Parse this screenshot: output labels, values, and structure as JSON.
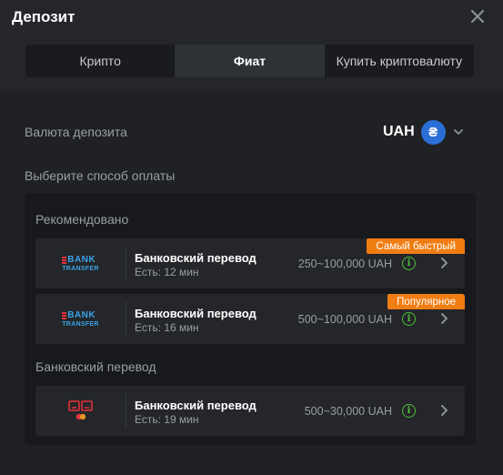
{
  "dialog": {
    "title": "Депозит",
    "close_icon": "close-icon"
  },
  "tabs": [
    {
      "label": "Крипто",
      "active": false
    },
    {
      "label": "Фиат",
      "active": true
    },
    {
      "label": "Купить криптовалюту",
      "active": false
    }
  ],
  "deposit_currency": {
    "label": "Валюта депозита",
    "code": "UAH",
    "symbol": "₴",
    "icon": "hryvnia-coin-icon",
    "dropdown_icon": "chevron-down-icon",
    "coin_color": "#2b6fd6"
  },
  "payment_method_prompt": "Выберите способ оплаты",
  "sections": [
    {
      "title": "Рекомендовано",
      "items": [
        {
          "logo": "bank-transfer-logo",
          "logo_text_top": "BANK",
          "logo_text_bottom": "TRANSFER",
          "name": "Банковский перевод",
          "eta": "Есть: 12 мин",
          "range": "250~100,000 UAH",
          "badge": "Самый быстрый"
        },
        {
          "logo": "bank-transfer-logo",
          "logo_text_top": "BANK",
          "logo_text_bottom": "TRANSFER",
          "name": "Банковский перевод",
          "eta": "Есть: 16 мин",
          "range": "500~100,000 UAH",
          "badge": "Популярное"
        }
      ]
    },
    {
      "title": "Банковский перевод",
      "items": [
        {
          "logo": "card-payment-logo",
          "name": "Банковский перевод",
          "eta": "Есть: 19 мин",
          "range": "500~30,000 UAH"
        }
      ]
    }
  ],
  "colors": {
    "background": "#1f2124",
    "header": "#24262a",
    "panel": "#17191c",
    "card": "#24262a",
    "badge": "#f07d12",
    "info": "#4fbf3a",
    "accent_blue": "#2b6fd6"
  }
}
